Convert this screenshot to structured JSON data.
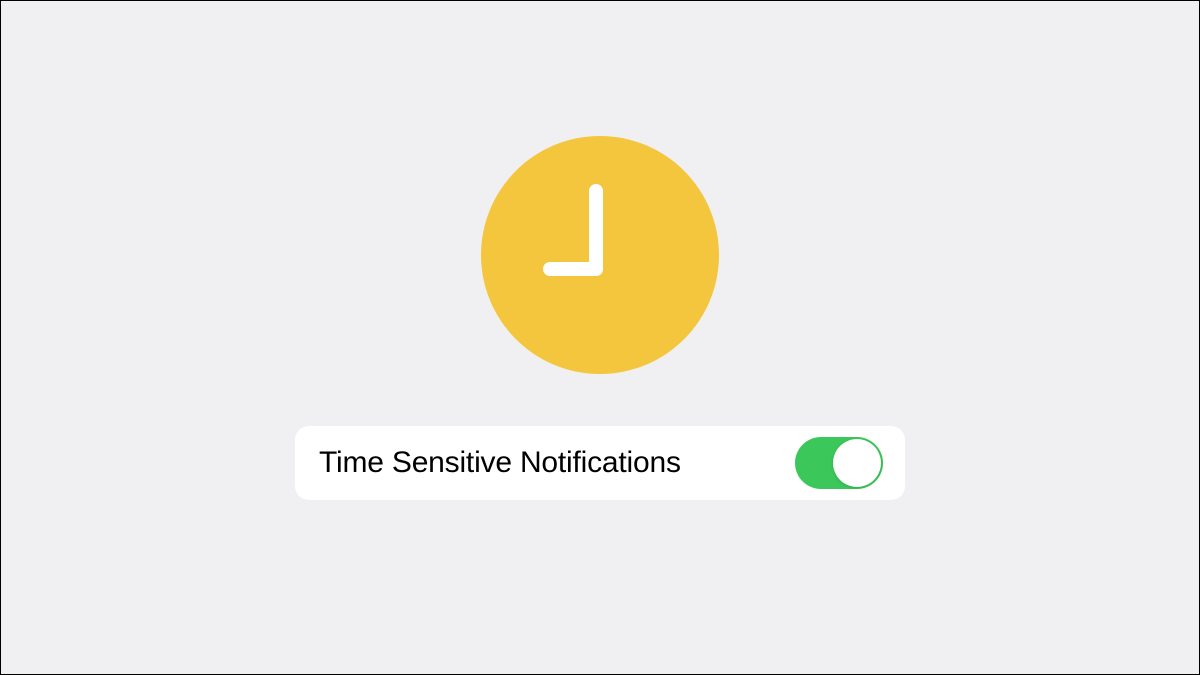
{
  "icon": {
    "name": "clock-icon",
    "color": "#f4c63e"
  },
  "setting": {
    "label": "Time Sensitive Notifications",
    "enabled": true,
    "toggle_color_on": "#3cc75a"
  }
}
